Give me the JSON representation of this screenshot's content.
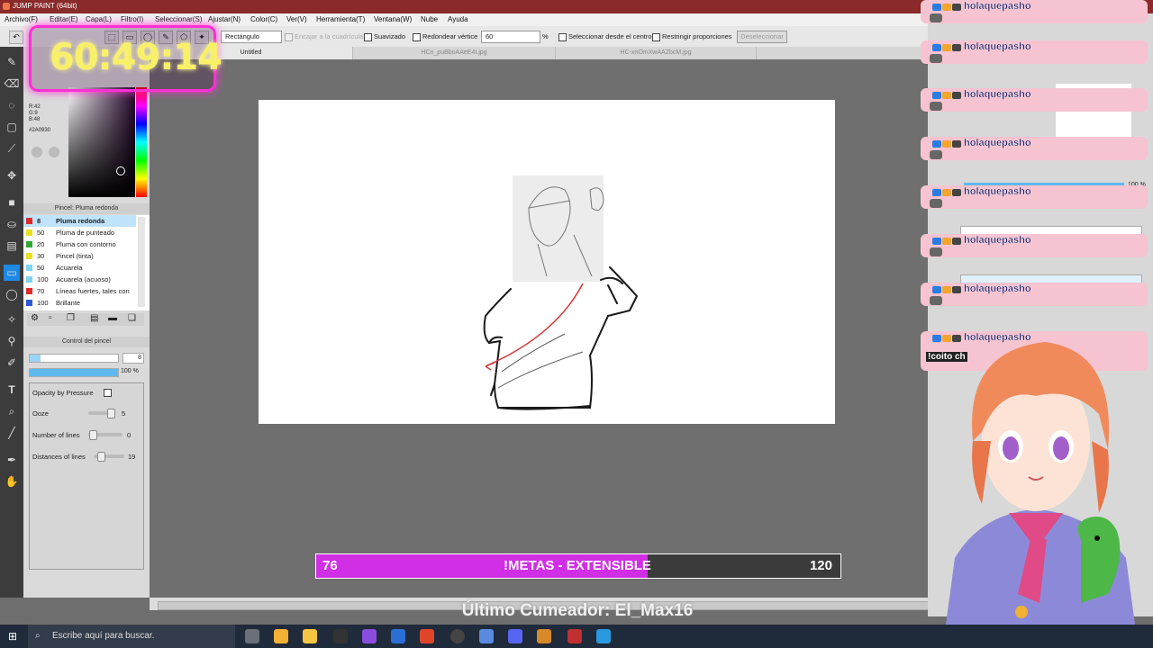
{
  "window": {
    "title": "JUMP PAINT (64bit)"
  },
  "menu": [
    "Archivo(F)",
    "Editar(E)",
    "Capa(L)",
    "Filtro(I)",
    "Seleccionar(S)",
    "Ajustar(N)",
    "Color(C)",
    "Ver(V)",
    "Herramienta(T)",
    "Ventana(W)",
    "Nube",
    "Ayuda"
  ],
  "toolbar": {
    "shape": "Rectángulo",
    "snap_label": "Encajar a la cuadrícula",
    "smooth_label": "Suavizado",
    "round_label": "Redondear vértice",
    "round_value": "60",
    "round_unit": "%",
    "from_center_label": "Seleccionar desde el centro",
    "restrict_label": "Restringir proporciones",
    "deselect_label": "Deseleccionar"
  },
  "tabs": [
    "Untitled",
    "HCn_puBboAAeE4I.jpg",
    "HC-xnOmXwAAZbcM.jpg"
  ],
  "timer": {
    "value": "60:49:14"
  },
  "color": {
    "r": "R:42",
    "g": "G:9",
    "b": "B:48",
    "hex": "#2A0930"
  },
  "brush_panel": {
    "title": "Pincel: Pluma redonda",
    "brushes": [
      {
        "size": "8",
        "name": "Pluma redonda",
        "color": "#e02a2a"
      },
      {
        "size": "50",
        "name": "Pluma de punteado",
        "color": "#e8e020"
      },
      {
        "size": "20",
        "name": "Pluma con contorno",
        "color": "#2ea82e"
      },
      {
        "size": "30",
        "name": "Pincel (tinta)",
        "color": "#e8e020"
      },
      {
        "size": "50",
        "name": "Acuarela",
        "color": "#7fd3ef"
      },
      {
        "size": "100",
        "name": "Acuarela (acuoso)",
        "color": "#7fd3ef"
      },
      {
        "size": "70",
        "name": "Líneas fuertes, tales con",
        "color": "#e02a2a"
      },
      {
        "size": "100",
        "name": "Brillante",
        "color": "#3057d8"
      }
    ]
  },
  "brush_control": {
    "title": "Control del pincel",
    "size_value": "8",
    "opacity_value": "100 %",
    "opacity_by_pressure_label": "Opacity by Pressure",
    "ooze_label": "Ooze",
    "ooze_value": "5",
    "number_of_lines_label": "Number of lines",
    "number_of_lines_value": "0",
    "distances_label": "Distances of lines",
    "distances_value": "19"
  },
  "right_panel": {
    "opacity": "100 %"
  },
  "chat": {
    "username": "holaquepasho",
    "messages": [
      {
        "user": "holaquepasho"
      },
      {
        "user": "holaquepasho"
      },
      {
        "user": "holaquepasho"
      },
      {
        "user": "holaquepasho"
      },
      {
        "user": "holaquepasho"
      },
      {
        "user": "holaquepasho"
      },
      {
        "user": "holaquepasho"
      },
      {
        "user": "holaquepasho"
      }
    ],
    "last_text": "!coito ch"
  },
  "meta_bar": {
    "current": "76",
    "label": "!METAS - EXTENSIBLE",
    "goal": "120",
    "progress": 0.633
  },
  "last_cumeador": "Último Cumeador: El_Max16",
  "taskbar": {
    "search_placeholder": "Escribe aquí para buscar."
  }
}
